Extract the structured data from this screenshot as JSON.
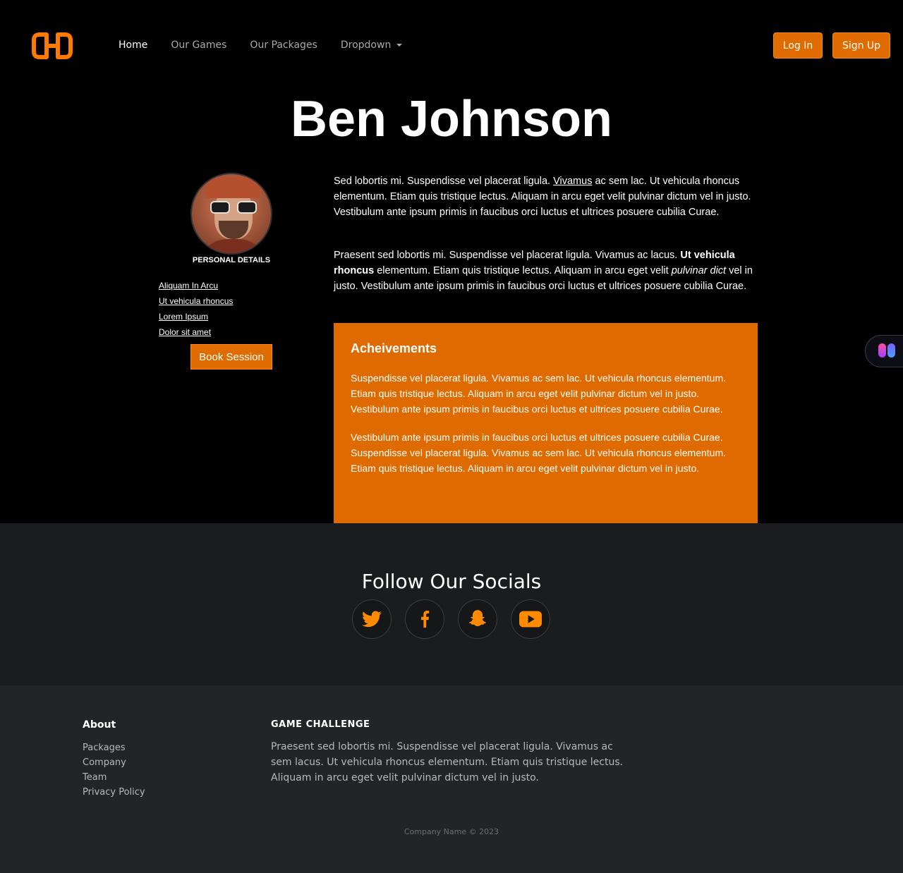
{
  "nav": {
    "links": [
      {
        "label": "Home",
        "active": true
      },
      {
        "label": "Our Games"
      },
      {
        "label": "Our Packages"
      },
      {
        "label": "Dropdown"
      }
    ],
    "login_label": "Log In",
    "signup_label": "Sign Up",
    "accent_color": "#e06c00"
  },
  "profile": {
    "name": "Ben Johnson",
    "details_title": "PERSONAL DETAILS",
    "links": [
      "Aliquam In Arcu",
      "Ut vehicula rhoncus",
      "Lorem Ipsum",
      "Dolor sit amet"
    ],
    "book_label": "Book Session"
  },
  "bio": {
    "p1_a": "Sed lobortis mi. Suspendisse vel placerat ligula. ",
    "p1_link": "Vivamus",
    "p1_b": " ac sem lac. Ut vehicula rhoncus elementum. Etiam quis tristique lectus. Aliquam in arcu eget velit pulvinar dictum vel in justo. Vestibulum ante ipsum primis in faucibus orci luctus et ultrices posuere cubilia Curae.",
    "p2_a": "Praesent sed lobortis mi. Suspendisse vel placerat ligula. Vivamus ac lacus. ",
    "p2_bold": "Ut vehicula rhoncus",
    "p2_b": " elementum. Etiam quis tristique lectus. Aliquam in arcu eget velit ",
    "p2_italic": "pulvinar dict",
    "p2_c": " vel in justo. Vestibulum ante ipsum primis in faucibus orci luctus et ultrices posuere cubilia Curae."
  },
  "achievements": {
    "title": "Acheivements",
    "p1": "Suspendisse vel placerat ligula. Vivamus ac sem lac. Ut vehicula rhoncus elementum. Etiam quis tristique lectus. Aliquam in arcu eget velit pulvinar dictum vel in justo. Vestibulum ante ipsum primis in faucibus orci luctus et ultrices posuere cubilia Curae.",
    "p2": "Vestibulum ante ipsum primis in faucibus orci luctus et ultrices posuere cubilia Curae. Suspendisse vel placerat ligula. Vivamus ac sem lac. Ut vehicula rhoncus elementum. Etiam quis tristique lectus. Aliquam in arcu eget velit pulvinar dictum vel in justo."
  },
  "socials": {
    "title": "Follow Our Socials",
    "icons": [
      "twitter-icon",
      "facebook-icon",
      "snapchat-icon",
      "youtube-icon"
    ]
  },
  "footer": {
    "about_title": "About",
    "about_links": [
      "Packages",
      "Company",
      "Team",
      "Privacy Policy"
    ],
    "game_title": "GAME CHALLENGE",
    "game_text": "Praesent sed lobortis mi. Suspendisse vel placerat ligula. Vivamus ac sem lacus. Ut vehicula rhoncus elementum. Etiam quis tristique lectus. Aliquam in arcu eget velit pulvinar dictum vel in justo.",
    "copyright": "Company Name © 2023"
  }
}
